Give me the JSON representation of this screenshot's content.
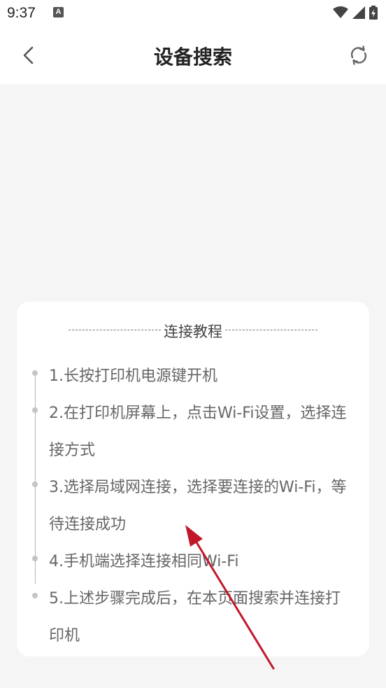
{
  "status_bar": {
    "time": "9:37",
    "notification_letter": "A"
  },
  "header": {
    "title": "设备搜索"
  },
  "tutorial": {
    "heading": "连接教程",
    "steps": [
      "1.长按打印机电源键开机",
      "2.在打印机屏幕上，点击Wi-Fi设置，选择连接方式",
      "3.选择局域网连接，选择要连接的Wi-Fi，等待连接成功",
      "4.手机端选择连接相同Wi-Fi",
      "5.上述步骤完成后，在本页面搜索并连接打印机"
    ]
  },
  "colors": {
    "background": "#f5f5f6",
    "card": "#ffffff",
    "step_text": "#666666",
    "annotation_arrow": "#c0182a"
  },
  "icons": {
    "back": "chevron-left-icon",
    "refresh": "refresh-icon",
    "wifi": "wifi-icon",
    "signal": "signal-icon",
    "battery": "battery-icon"
  }
}
